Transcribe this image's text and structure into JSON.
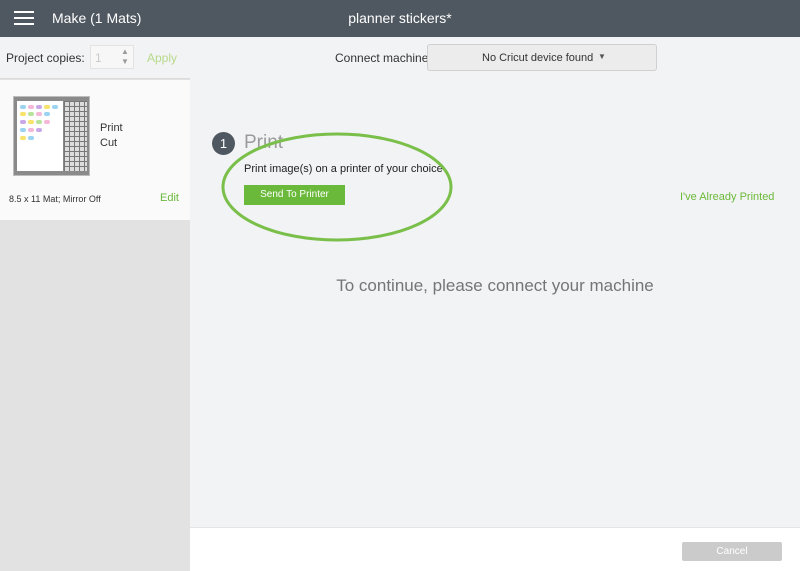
{
  "header": {
    "menu_icon": "hamburger-menu-icon",
    "title": "Make (1 Mats)",
    "document_title": "planner stickers*"
  },
  "sidebar": {
    "copies_label": "Project copies:",
    "copies_value": "1",
    "apply_label": "Apply",
    "mat": {
      "type_lines": [
        "Print",
        "Cut"
      ],
      "info": "8.5 x 11 Mat; Mirror Off",
      "edit_label": "Edit"
    }
  },
  "main": {
    "connect_label": "Connect machine",
    "device_dropdown": "No Cricut device found",
    "step": {
      "number": "1",
      "title": "Print",
      "description": "Print image(s) on a printer of your choice",
      "button_label": "Send To Printer",
      "already_label": "I've Already Printed"
    },
    "continue_message": "To continue, please connect your machine"
  },
  "footer": {
    "cancel_label": "Cancel"
  },
  "colors": {
    "header_bg": "#4f5860",
    "accent_green": "#6bb93a",
    "annotation_green": "#79bf4a",
    "disabled_gray": "#cbcbcb"
  }
}
